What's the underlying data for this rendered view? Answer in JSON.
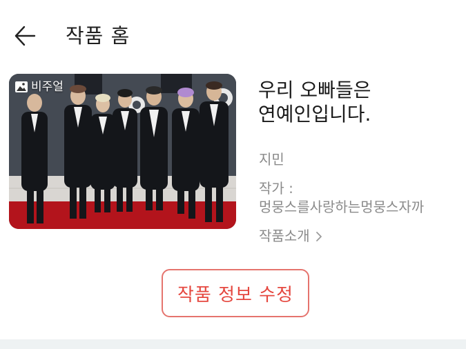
{
  "header": {
    "back_icon": "arrow-left-icon",
    "title": "작품 홈"
  },
  "cover": {
    "badge_icon": "image-icon",
    "badge_label": "비주얼",
    "description": ""
  },
  "work": {
    "title_line1": "우리 오빠들은",
    "title_line2": "연예인입니다.",
    "genre": "지민",
    "author_label": "작가 :",
    "author_name": "멍뭉스를사랑하는멍뭉스자까",
    "intro_label": "작품소개",
    "intro_icon": "chevron-right-icon"
  },
  "actions": {
    "edit_label": "작품 정보 수정"
  },
  "colors": {
    "accent": "#e5473f",
    "accent_border": "#e5736d",
    "muted_text": "#8a8a8a",
    "bottom_band": "#eef2f3"
  }
}
